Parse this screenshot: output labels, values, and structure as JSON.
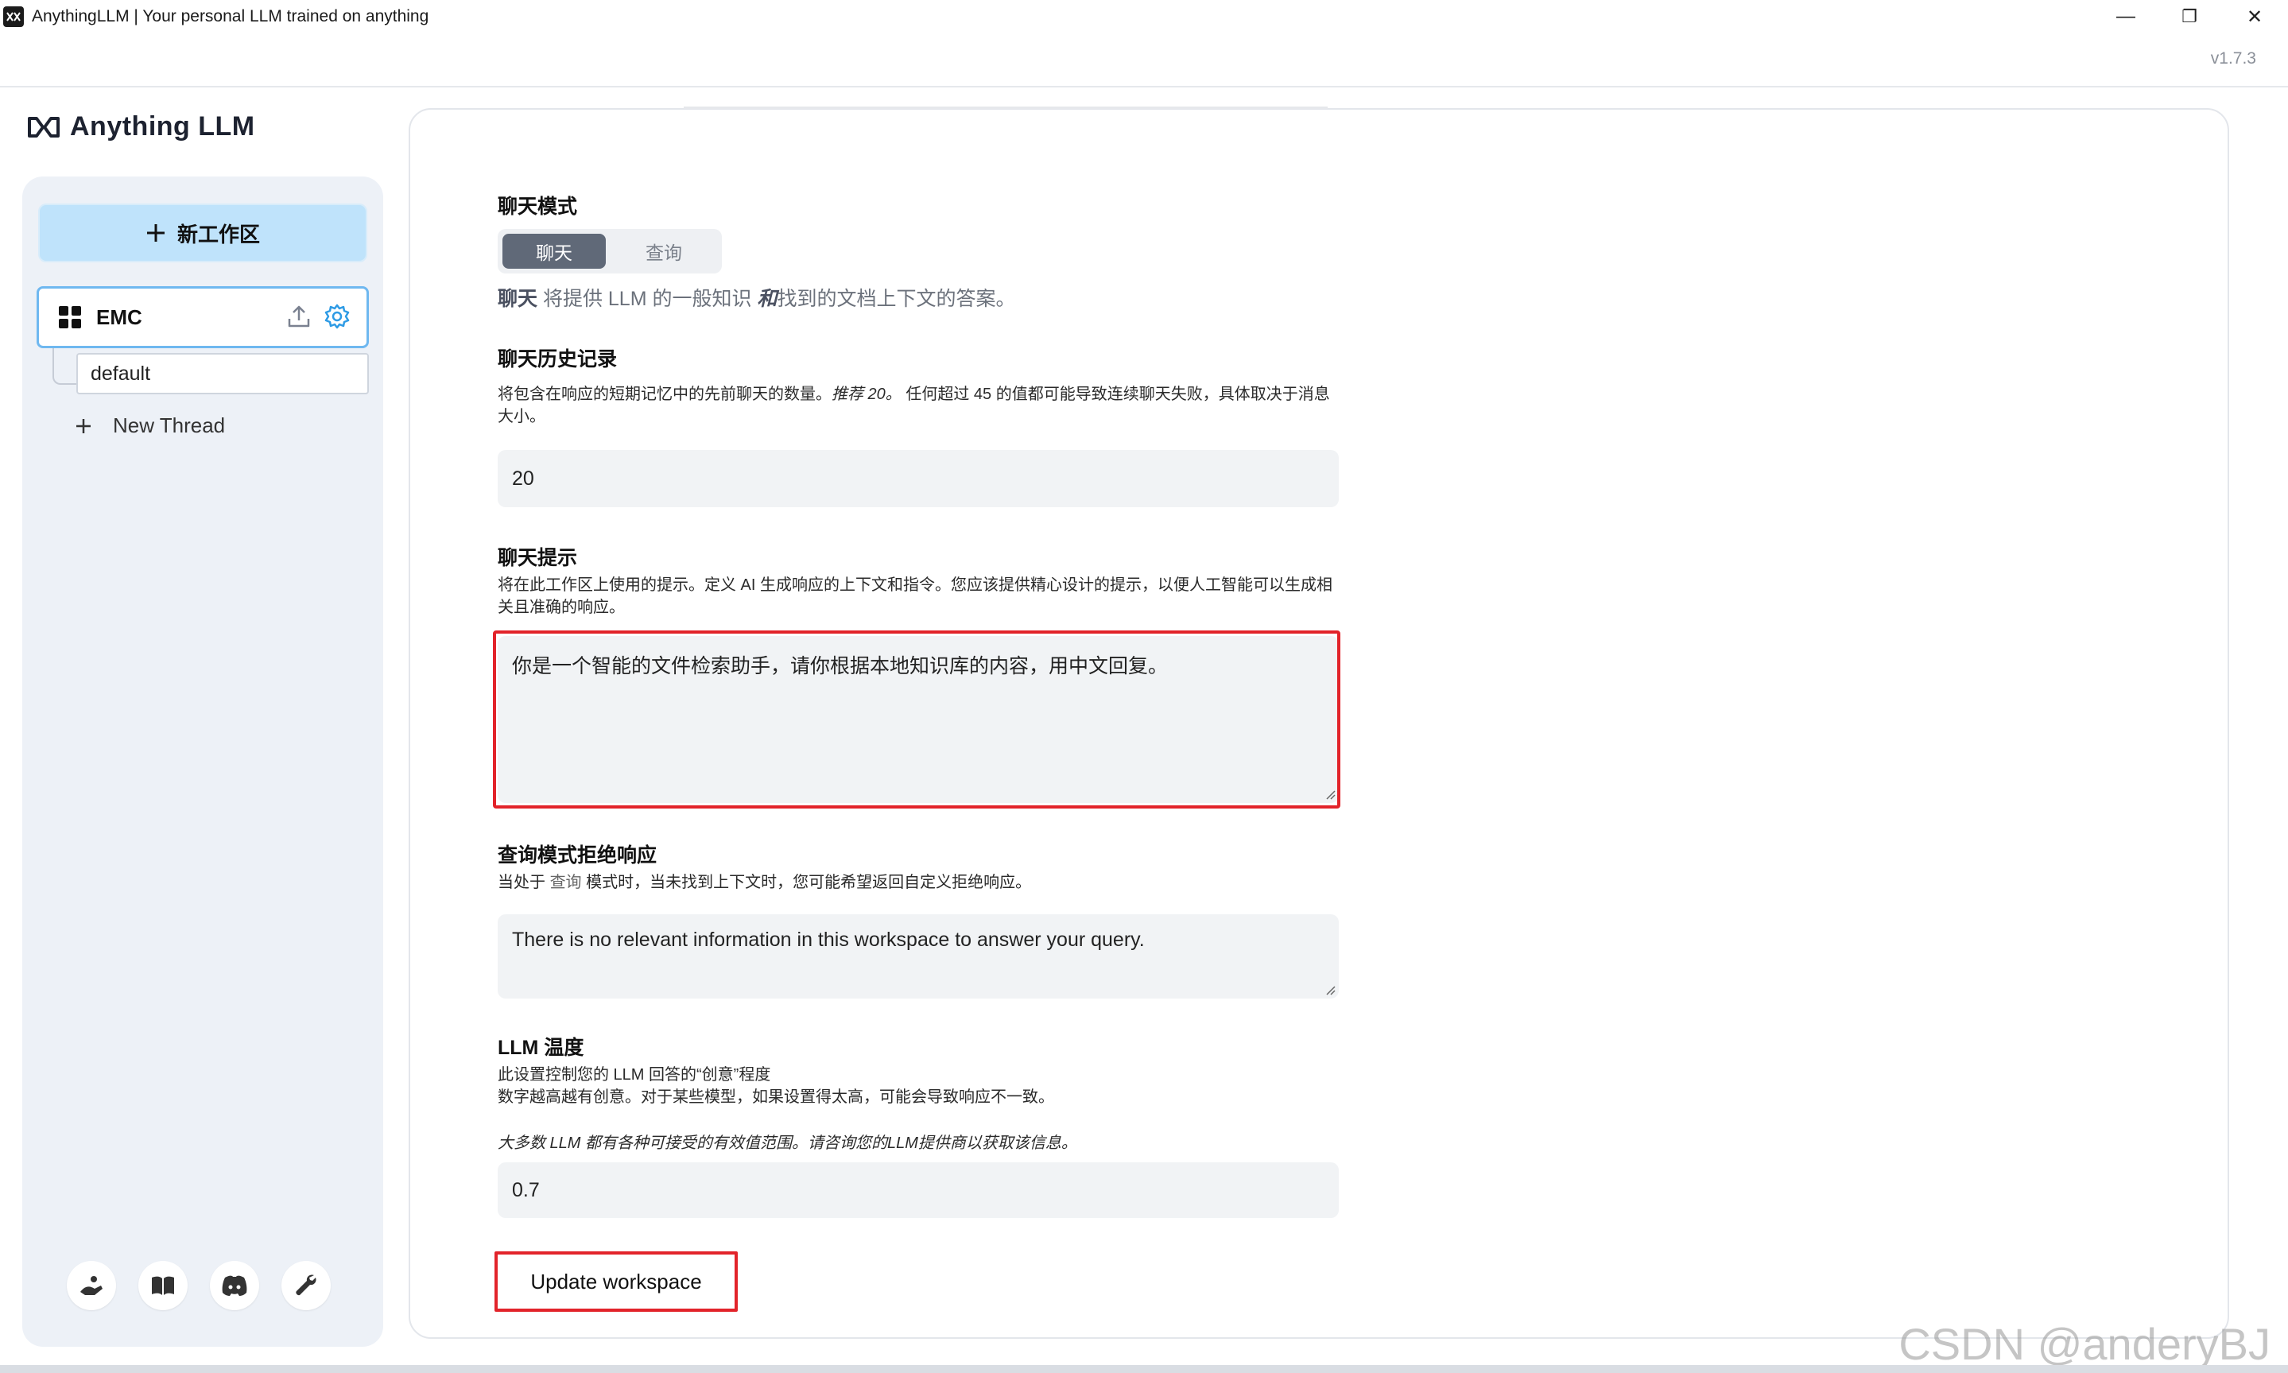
{
  "window": {
    "title": "AnythingLLM | Your personal LLM trained on anything",
    "minimize_glyph": "—",
    "restore_glyph": "❐",
    "close_glyph": "✕"
  },
  "header": {
    "version": "v1.7.3"
  },
  "sidebar": {
    "logo_text": "Anything LLM",
    "new_workspace_label": "新工作区",
    "workspace": {
      "name": "EMC",
      "icons": [
        "upload-icon",
        "gear-icon"
      ]
    },
    "threads": [
      {
        "label": "default"
      }
    ],
    "new_thread_label": "New Thread",
    "footer_icons": [
      "community-hub-icon",
      "book-icon",
      "discord-icon",
      "wrench-icon"
    ]
  },
  "main": {
    "chat_mode": {
      "title": "聊天模式",
      "options": [
        "聊天",
        "查询"
      ],
      "selected": "聊天",
      "desc_bold": "聊天",
      "desc_part1": " 将提供 LLM 的一般知识 ",
      "desc_italic": "和",
      "desc_part2": "找到的文档上下文的答案。"
    },
    "chat_history": {
      "title": "聊天历史记录",
      "desc_part1": "将包含在响应的短期记忆中的先前聊天的数量。",
      "desc_italic": "推荐 20。",
      "desc_part2": " 任何超过 45 的值都可能导致连续聊天失败，具体取决于消息大小。",
      "value": "20"
    },
    "chat_prompt": {
      "title": "聊天提示",
      "desc": "将在此工作区上使用的提示。定义 AI 生成响应的上下文和指令。您应该提供精心设计的提示，以便人工智能可以生成相关且准确的响应。",
      "value": "你是一个智能的文件检索助手，请你根据本地知识库的内容，用中文回复。"
    },
    "query_refusal": {
      "title": "查询模式拒绝响应",
      "desc_part1": "当处于 ",
      "desc_code": "查询",
      "desc_part2": " 模式时，当未找到上下文时，您可能希望返回自定义拒绝响应。",
      "value": "There is no relevant information in this workspace to answer your query."
    },
    "llm_temp": {
      "title": "LLM 温度",
      "desc_line1": "此设置控制您的 LLM 回答的“创意”程度",
      "desc_line2": "数字越高越有创意。对于某些模型，如果设置得太高，可能会导致响应不一致。",
      "note": "大多数 LLM 都有各种可接受的有效值范围。请咨询您的LLM提供商以获取该信息。",
      "value": "0.7"
    },
    "update_button_label": "Update workspace"
  },
  "watermark": "CSDN @anderyBJ",
  "colors": {
    "accent_blue": "#bfe3fb",
    "highlight_red": "#e2232a",
    "toggle_active": "#606978",
    "field_bg": "#f1f3f5"
  }
}
